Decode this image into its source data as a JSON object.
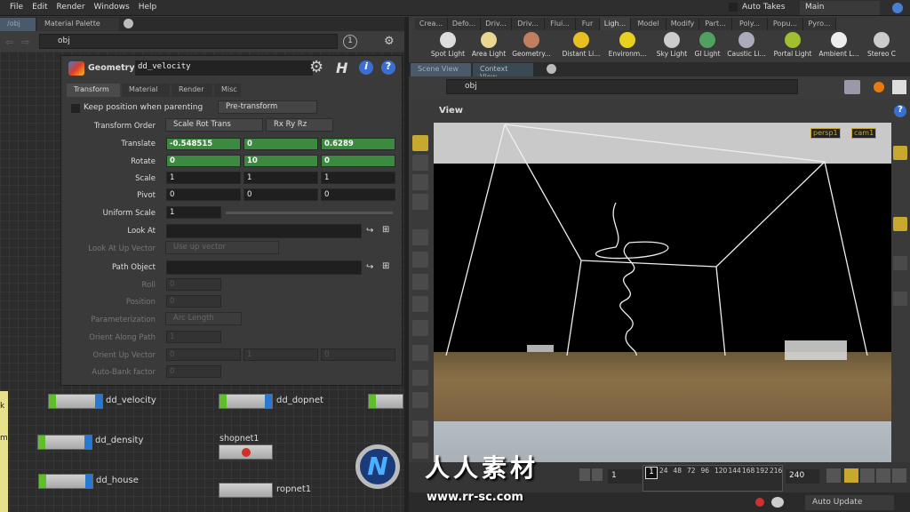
{
  "menu": [
    "File",
    "Edit",
    "Render",
    "Windows",
    "Help"
  ],
  "top_right": {
    "auto_takes": "Auto Takes",
    "take": "Main"
  },
  "left_panel": {
    "tabs": [
      "/obj",
      "Material Palette"
    ],
    "path": "obj",
    "badge": "1",
    "node_type": "Geometry",
    "node_name": "dd_velocity",
    "param_tabs": [
      "Transform",
      "Material",
      "Render",
      "Misc"
    ],
    "keep_position": "Keep position when parenting",
    "pre_transform": "Pre-transform",
    "params": {
      "transform_order": {
        "label": "Transform Order",
        "value": "Scale Rot Trans",
        "rot": "Rx Ry Rz"
      },
      "translate": {
        "label": "Translate",
        "values": [
          "-0.548515",
          "0",
          "0.6289"
        ]
      },
      "rotate": {
        "label": "Rotate",
        "values": [
          "0",
          "10",
          "0"
        ]
      },
      "scale": {
        "label": "Scale",
        "values": [
          "1",
          "1",
          "1"
        ]
      },
      "pivot": {
        "label": "Pivot",
        "values": [
          "0",
          "0",
          "0"
        ]
      },
      "uniform_scale": {
        "label": "Uniform Scale",
        "value": "1"
      },
      "look_at": {
        "label": "Look At",
        "value": ""
      },
      "look_at_up": {
        "label": "Look At Up Vector",
        "value": "Use up vector"
      },
      "path_object": {
        "label": "Path Object",
        "value": ""
      },
      "roll": {
        "label": "Roll",
        "value": "0"
      },
      "position": {
        "label": "Position",
        "value": "0"
      },
      "parameterization": {
        "label": "Parameterization",
        "value": "Arc Length"
      },
      "orient_along_path": {
        "label": "Orient Along Path",
        "value": "1"
      },
      "orient_up_vector": {
        "label": "Orient Up Vector",
        "values": [
          "0",
          "1",
          "0"
        ]
      },
      "auto_bank": {
        "label": "Auto-Bank factor",
        "value": "0"
      }
    },
    "nodes": [
      "dd_velocity",
      "dd_density",
      "dd_house",
      "dd_dopnet",
      "shopnet1",
      "ropnet1"
    ],
    "sticky": [
      "k",
      "m"
    ]
  },
  "shelf": {
    "tabs": [
      "Crea...",
      "Defo...",
      "Driv...",
      "Driv...",
      "Flui...",
      "Fur",
      "Ligh...",
      "Model",
      "Modify",
      "Part...",
      "Poly...",
      "Popu...",
      "Pyro..."
    ],
    "tools": [
      "Spot Light",
      "Area Light",
      "Geometry...",
      "Distant Li...",
      "Environm...",
      "Sky Light",
      "GI Light",
      "Caustic Li...",
      "Portal Light",
      "Ambient L...",
      "Stereo C"
    ]
  },
  "viewer": {
    "tabs": [
      "Scene View",
      "Context View"
    ],
    "path": "obj",
    "title": "View",
    "camera": "persp1",
    "cam2": "cam1"
  },
  "timeline": {
    "frame": "1",
    "start": "1",
    "end": "240",
    "ticks": [
      "24",
      "48",
      "72",
      "96",
      "120",
      "144",
      "168",
      "192",
      "216"
    ]
  },
  "status": {
    "update": "Auto Update"
  },
  "watermark": {
    "text": "人人素材",
    "url": "www.rr-sc.com"
  },
  "colors": {
    "accent_green": "#3b8a3f",
    "node_green": "#5fbf2a",
    "node_blue": "#2a78d0"
  }
}
